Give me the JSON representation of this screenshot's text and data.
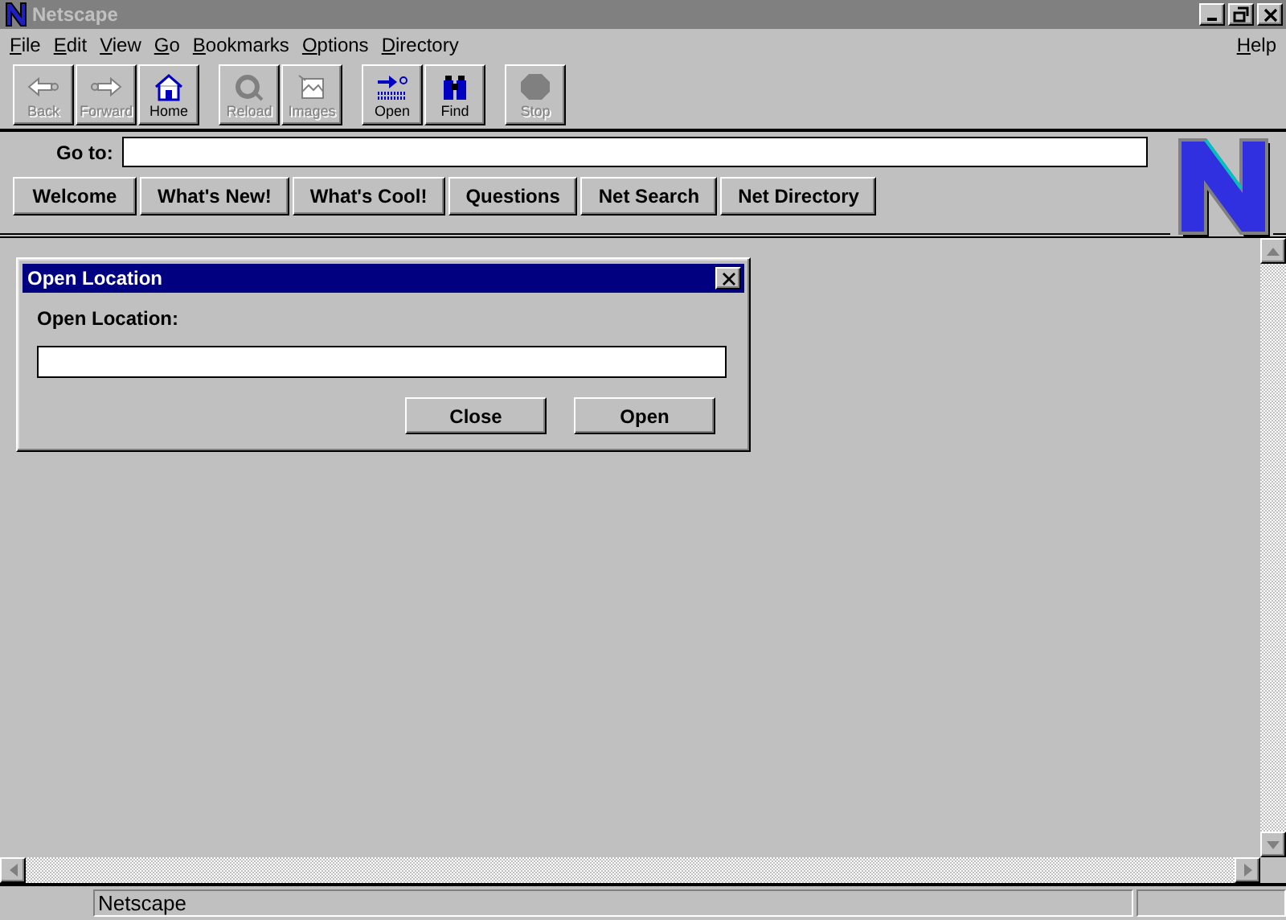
{
  "window": {
    "title": "Netscape"
  },
  "menu": {
    "left": [
      "File",
      "Edit",
      "View",
      "Go",
      "Bookmarks",
      "Options",
      "Directory"
    ],
    "right": [
      "Help"
    ]
  },
  "toolbar": [
    [
      {
        "label": "Back",
        "kind": "back",
        "disabled": true
      },
      {
        "label": "Forward",
        "kind": "forward",
        "disabled": true
      },
      {
        "label": "Home",
        "kind": "home",
        "disabled": false
      }
    ],
    [
      {
        "label": "Reload",
        "kind": "reload",
        "disabled": true
      },
      {
        "label": "Images",
        "kind": "images",
        "disabled": true
      }
    ],
    [
      {
        "label": "Open",
        "kind": "open",
        "disabled": false
      },
      {
        "label": "Find",
        "kind": "find",
        "disabled": false
      }
    ],
    [
      {
        "label": "Stop",
        "kind": "stop",
        "disabled": true
      }
    ]
  ],
  "location": {
    "label": "Go to:"
  },
  "directory_buttons": [
    "Welcome",
    "What's New!",
    "What's Cool!",
    "Questions",
    "Net Search",
    "Net Directory"
  ],
  "dialog": {
    "title": "Open Location",
    "label": "Open Location:",
    "buttons": [
      "Close",
      "Open"
    ]
  },
  "status_bar": {
    "message": "Netscape"
  }
}
